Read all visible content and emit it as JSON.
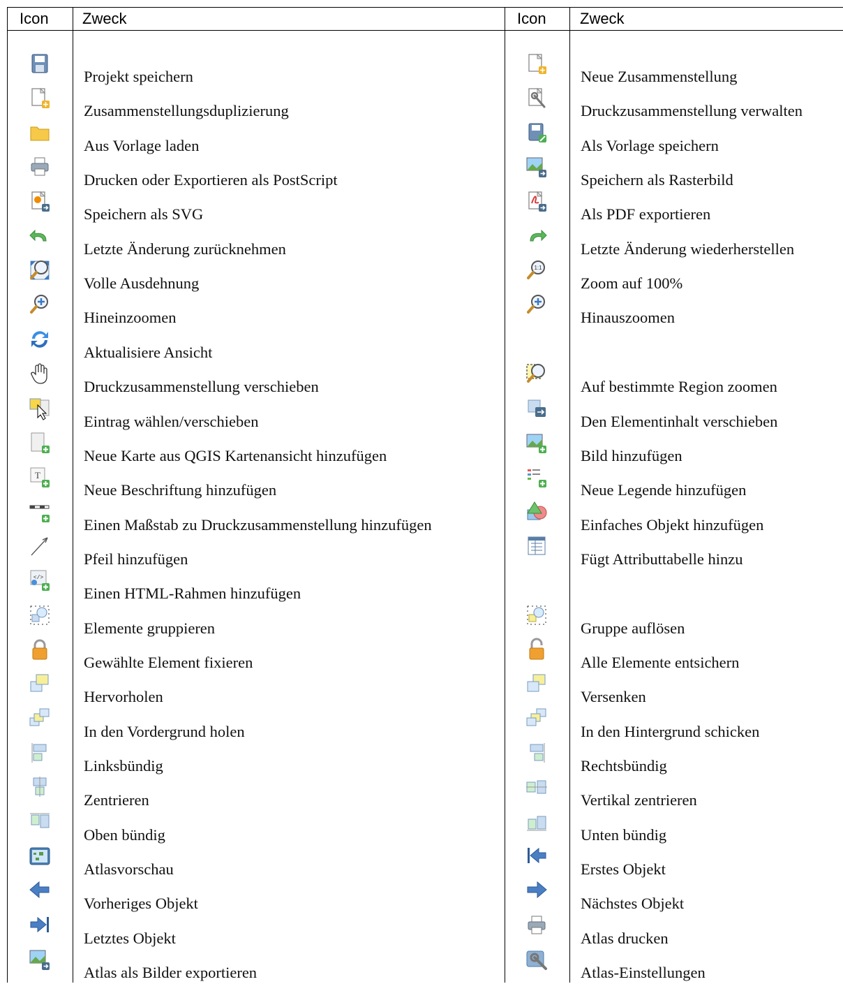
{
  "table": {
    "header": {
      "icon_col": "Icon",
      "purpose_col": "Zweck"
    },
    "left": [
      {
        "label": "Projekt speichern",
        "icon": "save-icon"
      },
      {
        "label": "Zusammenstellungsduplizierung",
        "icon": "duplicate-composer-icon"
      },
      {
        "label": "Aus Vorlage laden",
        "icon": "folder-icon"
      },
      {
        "label": "Drucken oder Exportieren als PostScript",
        "icon": "print-icon"
      },
      {
        "label": "Speichern als SVG",
        "icon": "svg-export-icon"
      },
      {
        "label": "Letzte Änderung zurücknehmen",
        "icon": "undo-icon"
      },
      {
        "label": "Volle Ausdehnung",
        "icon": "zoom-full-icon"
      },
      {
        "label": "Hineinzoomen",
        "icon": "zoom-in-icon"
      },
      {
        "label": "Aktualisiere Ansicht",
        "icon": "refresh-icon"
      },
      {
        "label": "Druckzusammenstellung verschieben",
        "icon": "pan-hand-icon"
      },
      {
        "label": "Eintrag wählen/verschieben",
        "icon": "select-move-icon"
      },
      {
        "label": "Neue Karte aus QGIS Kartenansicht hinzufügen",
        "icon": "add-map-icon"
      },
      {
        "label": "Neue Beschriftung hinzufügen",
        "icon": "add-label-icon"
      },
      {
        "label": "Einen Maßstab zu Druckzusammenstellung hinzufügen",
        "icon": "add-scalebar-icon"
      },
      {
        "label": "Pfeil hinzufügen",
        "icon": "add-arrow-icon"
      },
      {
        "label": "Einen HTML-Rahmen hinzufügen",
        "icon": "add-html-icon"
      },
      {
        "label": "Elemente gruppieren",
        "icon": "group-items-icon"
      },
      {
        "label": "Gewählte Element fixieren",
        "icon": "lock-icon"
      },
      {
        "label": "Hervorholen",
        "icon": "raise-icon"
      },
      {
        "label": "In den Vordergrund holen",
        "icon": "bring-front-icon"
      },
      {
        "label": "Linksbündig",
        "icon": "align-left-icon"
      },
      {
        "label": "Zentrieren",
        "icon": "align-center-icon"
      },
      {
        "label": "Oben bündig",
        "icon": "align-top-icon"
      },
      {
        "label": "Atlasvorschau",
        "icon": "atlas-preview-icon"
      },
      {
        "label": "Vorheriges Objekt",
        "icon": "arrow-left-icon"
      },
      {
        "label": "Letztes Objekt",
        "icon": "last-icon"
      },
      {
        "label": "Atlas als Bilder exportieren",
        "icon": "export-image-icon"
      }
    ],
    "right": [
      {
        "label": "Neue Zusammenstellung",
        "icon": "new-composer-icon"
      },
      {
        "label": "Druckzusammenstellung verwalten",
        "icon": "manage-composer-icon"
      },
      {
        "label": "Als Vorlage speichern",
        "icon": "save-template-icon"
      },
      {
        "label": "Speichern als Rasterbild",
        "icon": "export-image-icon"
      },
      {
        "label": "Als PDF exportieren",
        "icon": "pdf-export-icon"
      },
      {
        "label": "Letzte Änderung wiederherstellen",
        "icon": "redo-icon"
      },
      {
        "label": "Zoom auf 100%",
        "icon": "zoom-actual-icon"
      },
      {
        "label": "Hinauszoomen",
        "icon": "zoom-in-icon"
      },
      {
        "label": "",
        "icon": ""
      },
      {
        "label": "Auf bestimmte Region zoomen",
        "icon": "zoom-region-icon"
      },
      {
        "label": "Den Elementinhalt verschieben",
        "icon": "move-content-icon"
      },
      {
        "label": "Bild hinzufügen",
        "icon": "add-image-icon"
      },
      {
        "label": "Neue Legende hinzufügen",
        "icon": "add-legend-icon"
      },
      {
        "label": "Einfaches Objekt hinzufügen",
        "icon": "add-shape-icon"
      },
      {
        "label": "Fügt Attributtabelle hinzu",
        "icon": "add-table-icon"
      },
      {
        "label": "",
        "icon": ""
      },
      {
        "label": "Gruppe auflösen",
        "icon": "ungroup-icon"
      },
      {
        "label": "Alle Elemente entsichern",
        "icon": "unlock-icon"
      },
      {
        "label": "Versenken",
        "icon": "lower-icon"
      },
      {
        "label": "In den Hintergrund schicken",
        "icon": "send-back-icon"
      },
      {
        "label": "Rechtsbündig",
        "icon": "align-right-icon"
      },
      {
        "label": "Vertikal zentrieren",
        "icon": "align-vcenter-icon"
      },
      {
        "label": "Unten bündig",
        "icon": "align-bottom-icon"
      },
      {
        "label": "Erstes Objekt",
        "icon": "first-icon"
      },
      {
        "label": "Nächstes Objekt",
        "icon": "arrow-right-icon"
      },
      {
        "label": "Atlas drucken",
        "icon": "print-icon"
      },
      {
        "label": "Atlas-Einstellungen",
        "icon": "atlas-settings-icon"
      }
    ]
  }
}
